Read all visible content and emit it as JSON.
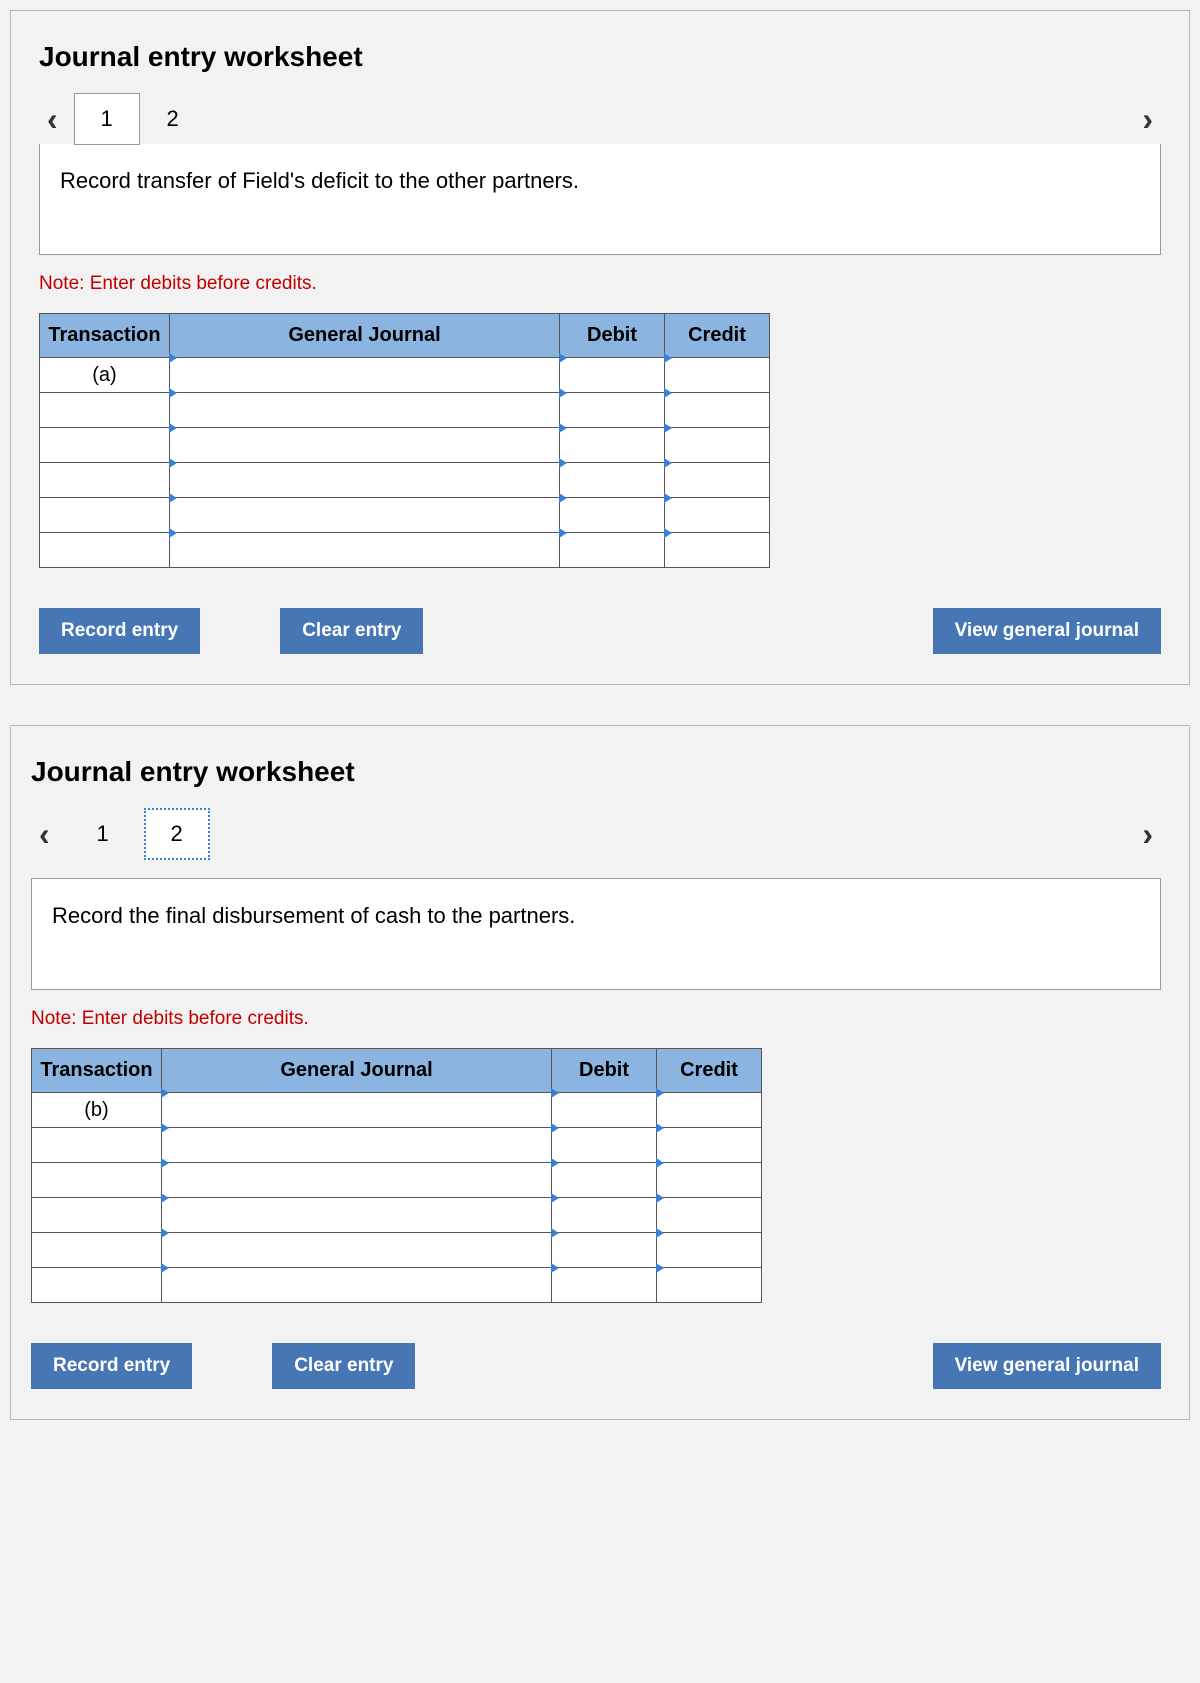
{
  "worksheets": [
    {
      "title": "Journal entry worksheet",
      "tabs": [
        "1",
        "2"
      ],
      "prompt": "Record transfer of Field's deficit to the other partners.",
      "note": "Note: Enter debits before credits.",
      "columns": {
        "transaction": "Transaction",
        "general_journal": "General Journal",
        "debit": "Debit",
        "credit": "Credit"
      },
      "rows": [
        {
          "transaction": "(a)",
          "general_journal": "",
          "debit": "",
          "credit": ""
        },
        {
          "transaction": "",
          "general_journal": "",
          "debit": "",
          "credit": ""
        },
        {
          "transaction": "",
          "general_journal": "",
          "debit": "",
          "credit": ""
        },
        {
          "transaction": "",
          "general_journal": "",
          "debit": "",
          "credit": ""
        },
        {
          "transaction": "",
          "general_journal": "",
          "debit": "",
          "credit": ""
        },
        {
          "transaction": "",
          "general_journal": "",
          "debit": "",
          "credit": ""
        }
      ],
      "buttons": {
        "record": "Record entry",
        "clear": "Clear entry",
        "view": "View general journal"
      }
    },
    {
      "title": "Journal entry worksheet",
      "tabs": [
        "1",
        "2"
      ],
      "prompt": "Record the final disbursement of cash to the partners.",
      "note": "Note: Enter debits before credits.",
      "columns": {
        "transaction": "Transaction",
        "general_journal": "General Journal",
        "debit": "Debit",
        "credit": "Credit"
      },
      "rows": [
        {
          "transaction": "(b)",
          "general_journal": "",
          "debit": "",
          "credit": ""
        },
        {
          "transaction": "",
          "general_journal": "",
          "debit": "",
          "credit": ""
        },
        {
          "transaction": "",
          "general_journal": "",
          "debit": "",
          "credit": ""
        },
        {
          "transaction": "",
          "general_journal": "",
          "debit": "",
          "credit": ""
        },
        {
          "transaction": "",
          "general_journal": "",
          "debit": "",
          "credit": ""
        },
        {
          "transaction": "",
          "general_journal": "",
          "debit": "",
          "credit": ""
        }
      ],
      "buttons": {
        "record": "Record entry",
        "clear": "Clear entry",
        "view": "View general journal"
      }
    }
  ]
}
